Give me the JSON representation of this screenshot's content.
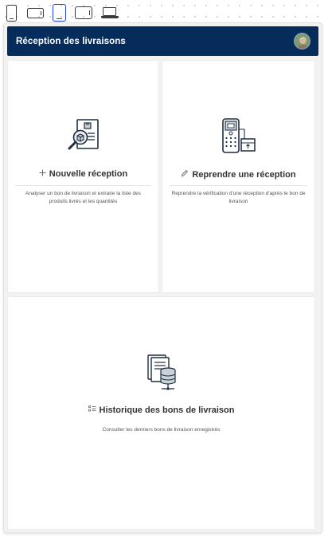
{
  "app": {
    "title": "Réception des livraisons",
    "avatar_icon": "user-avatar"
  },
  "device_bar": [
    {
      "icon": "phone-portrait-icon",
      "selected": false
    },
    {
      "icon": "phone-landscape-icon",
      "selected": false
    },
    {
      "icon": "tablet-portrait-icon",
      "selected": true
    },
    {
      "icon": "tablet-landscape-icon",
      "selected": false
    },
    {
      "icon": "laptop-icon",
      "selected": false
    }
  ],
  "cards": {
    "new_reception": {
      "prefix_icon": "plus-icon",
      "title": "Nouvelle réception",
      "description": "Analyser un bon de livraison et extraire la liste des produits livrés et les quantités",
      "illustration": "document-search-package-icon"
    },
    "resume_reception": {
      "prefix_icon": "pencil-icon",
      "title": "Reprendre une réception",
      "description": "Reprendre la vérification d'une réception d'après le bon de livraison",
      "illustration": "barcode-scanner-package-icon"
    },
    "history": {
      "prefix_icon": "list-icon",
      "title": "Historique des bons de livraison",
      "description": "Consulter les derniers bons de livraison enregistrés",
      "illustration": "documents-database-icon"
    }
  },
  "colors": {
    "header_bg": "#062c5c",
    "selected_device": "#1d3fdb",
    "illustration_stroke": "#1f2d40",
    "illustration_fill": "#c9d1d9"
  }
}
